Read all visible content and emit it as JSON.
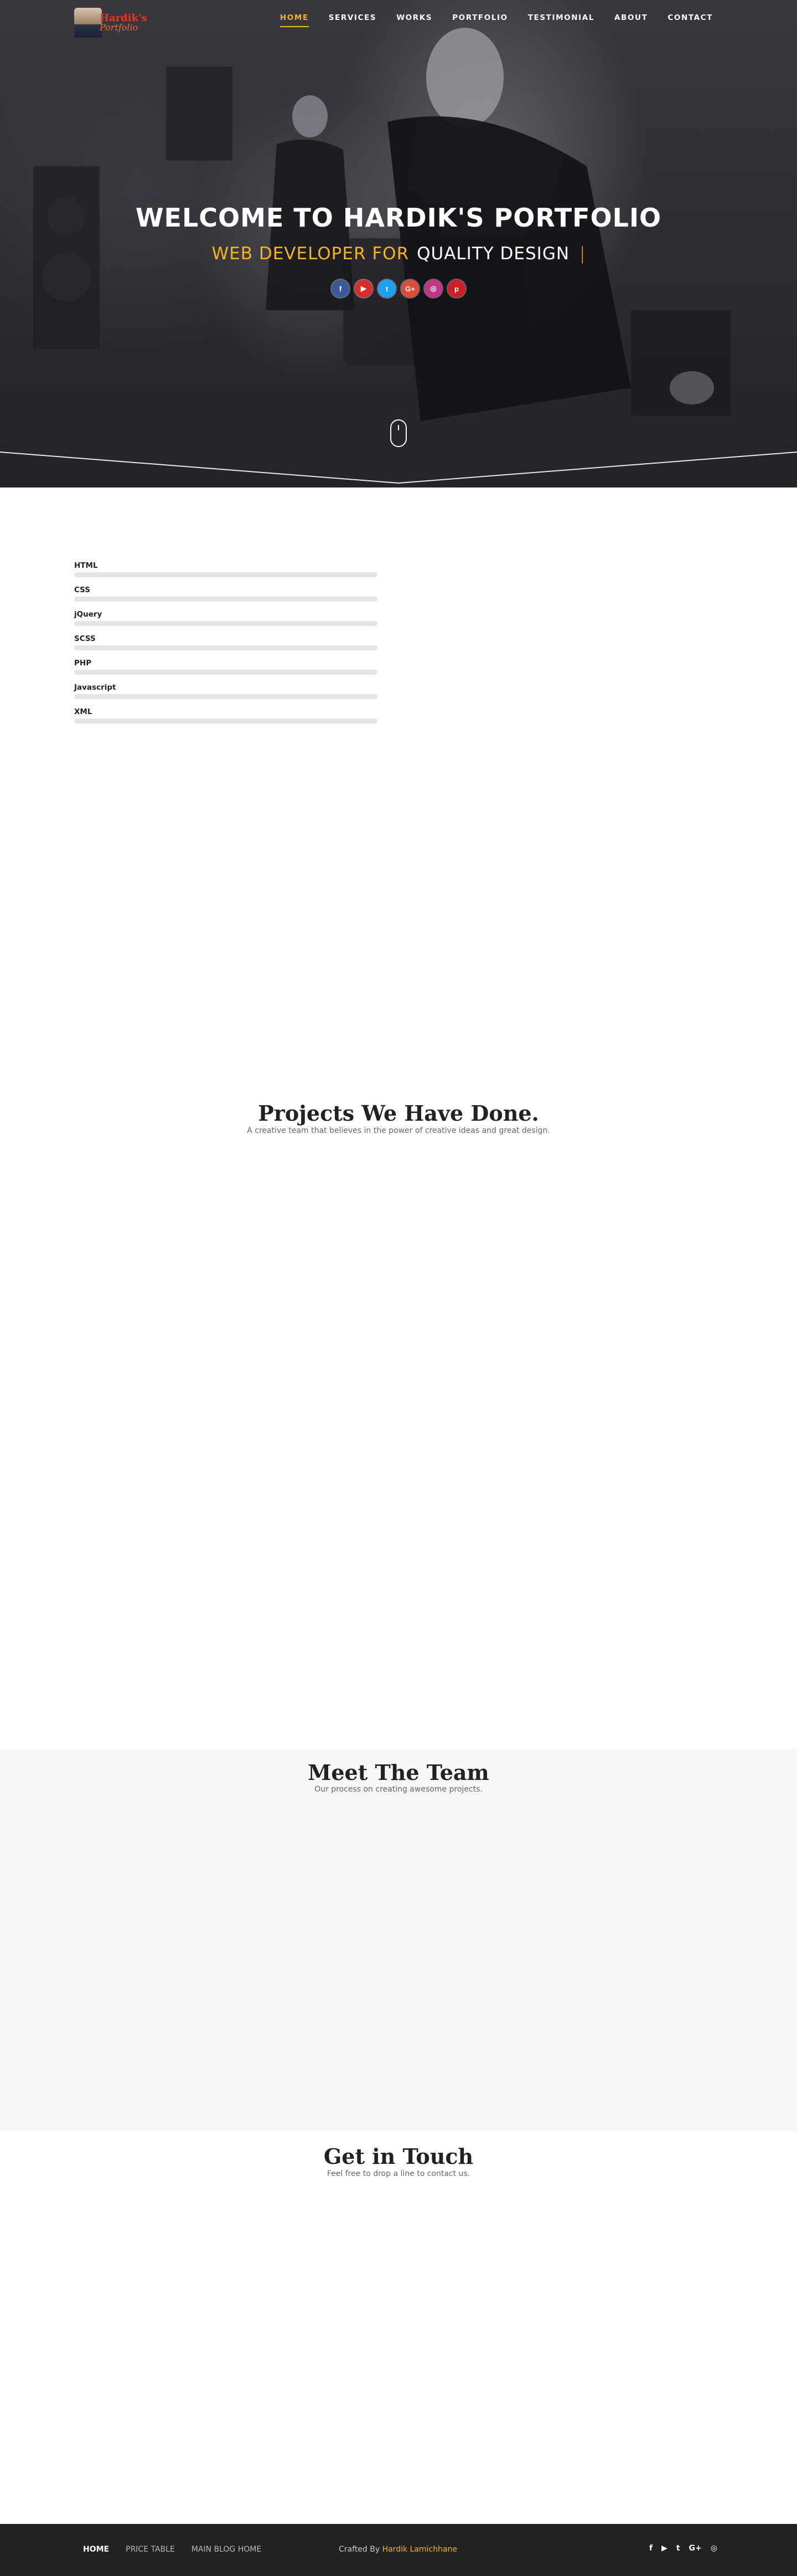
{
  "brand": {
    "logo_line1": "Hardik's",
    "logo_line2": "Portfolio"
  },
  "nav": {
    "items": [
      {
        "label": "HOME",
        "active": true
      },
      {
        "label": "SERVICES",
        "active": false
      },
      {
        "label": "WORKS",
        "active": false
      },
      {
        "label": "PORTFOLIO",
        "active": false
      },
      {
        "label": "TESTIMONIAL",
        "active": false
      },
      {
        "label": "ABOUT",
        "active": false
      },
      {
        "label": "CONTACT",
        "active": false
      }
    ]
  },
  "hero": {
    "title": "WELCOME TO HARDIK'S PORTFOLIO",
    "subtitle_accent": "WEB DEVELOPER FOR",
    "subtitle_rest": "QUALITY DESIGN",
    "caret": "|",
    "social": [
      {
        "icon": "facebook-icon",
        "glyph": "f",
        "color": "#3b5998"
      },
      {
        "icon": "youtube-icon",
        "glyph": "▶",
        "color": "#d62d2d"
      },
      {
        "icon": "twitter-icon",
        "glyph": "t",
        "color": "#1da1f2"
      },
      {
        "icon": "google-plus-icon",
        "glyph": "G+",
        "color": "#dd4b39"
      },
      {
        "icon": "instagram-icon",
        "glyph": "◎",
        "color": "#c13584"
      },
      {
        "icon": "pinterest-icon",
        "glyph": "p",
        "color": "#cb2027"
      }
    ]
  },
  "skills": {
    "items": [
      {
        "label": "HTML",
        "level": 0
      },
      {
        "label": "CSS",
        "level": 0
      },
      {
        "label": "jQuery",
        "level": 0
      },
      {
        "label": "SCSS",
        "level": 0
      },
      {
        "label": "PHP",
        "level": 0
      },
      {
        "label": "Javascript",
        "level": 0
      },
      {
        "label": "XML",
        "level": 0
      }
    ]
  },
  "projects": {
    "title": "Projects We Have Done.",
    "subtitle": "A creative team that believes in the power of creative ideas and great design."
  },
  "team": {
    "title": "Meet The Team",
    "subtitle": "Our process on creating awesome projects."
  },
  "contact": {
    "title": "Get in Touch",
    "subtitle": "Feel free to drop a line to contact us."
  },
  "footer": {
    "links": [
      {
        "label": "HOME",
        "active": true
      },
      {
        "label": "PRICE TABLE",
        "active": false
      },
      {
        "label": "MAIN BLOG HOME",
        "active": false
      }
    ],
    "credit_prefix": "Crafted By",
    "credit_name": "Hardik Lamichhane",
    "social": [
      {
        "icon": "facebook-icon",
        "glyph": "f"
      },
      {
        "icon": "youtube-icon",
        "glyph": "▶"
      },
      {
        "icon": "twitter-icon",
        "glyph": "t"
      },
      {
        "icon": "google-plus-icon",
        "glyph": "G+"
      },
      {
        "icon": "instagram-icon",
        "glyph": "◎"
      }
    ]
  },
  "colors": {
    "accent": "#f3b51a",
    "footer_bg": "#222222",
    "hero_dark": "#2e2b32"
  }
}
